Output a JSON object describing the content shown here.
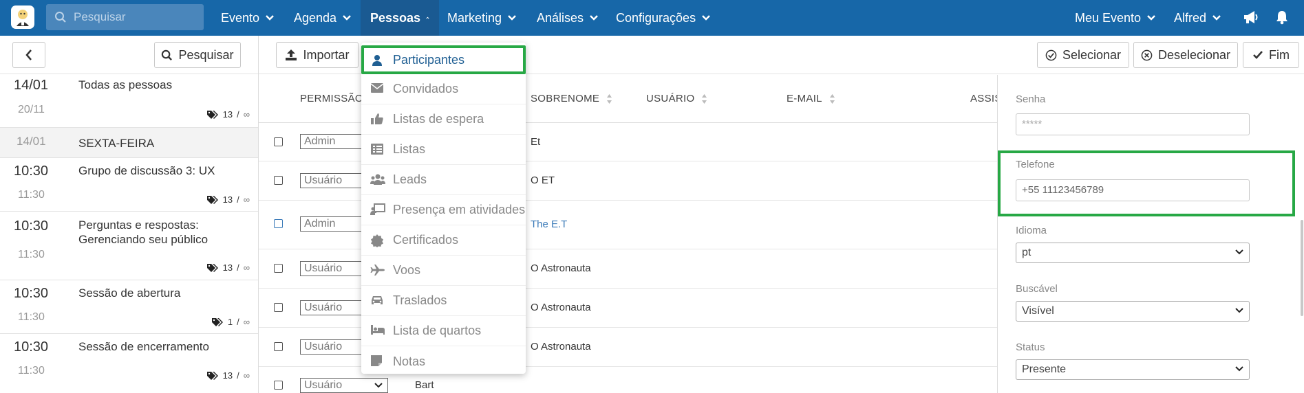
{
  "nav": {
    "search_placeholder": "Pesquisar",
    "items": [
      "Evento",
      "Agenda",
      "Pessoas",
      "Marketing",
      "Análises",
      "Configurações"
    ],
    "active": "Pessoas",
    "right_items": [
      "Meu Evento",
      "Alfred"
    ]
  },
  "toolbar": {
    "search_label": "Pesquisar",
    "import_label": "Importar",
    "select_label": "Selecionar",
    "deselect_label": "Deselecionar",
    "done_label": "Fim"
  },
  "sessions": [
    {
      "start": "14/01",
      "end": "20/11",
      "title": "Todas as pessoas",
      "tags": "13",
      "inf": "∞"
    },
    {
      "start": "14/01",
      "end": "",
      "title": "SEXTA-FEIRA",
      "tags": "",
      "inf": ""
    },
    {
      "start": "10:30",
      "end": "11:30",
      "title": "Grupo de discussão 3: UX",
      "tags": "13",
      "inf": "∞"
    },
    {
      "start": "10:30",
      "end": "11:30",
      "title": "Perguntas e respostas: Gerenciando seu público",
      "tags": "13",
      "inf": "∞"
    },
    {
      "start": "10:30",
      "end": "11:30",
      "title": "Sessão de abertura",
      "tags": "1",
      "inf": "∞"
    },
    {
      "start": "10:30",
      "end": "11:30",
      "title": "Sessão de encerramento",
      "tags": "13",
      "inf": "∞"
    }
  ],
  "table": {
    "headers": [
      "PERMISSÃO",
      "SOBRENOME",
      "USUÁRIO",
      "E-MAIL",
      "ASSIS"
    ],
    "rows": [
      {
        "permission": "Admin",
        "surname": "Et"
      },
      {
        "permission": "Usuário",
        "surname": "O ET"
      },
      {
        "permission": "Admin",
        "surname": "The E.T"
      },
      {
        "permission": "Usuário",
        "surname": "O Astronauta"
      },
      {
        "permission": "Usuário",
        "surname": "O Astronauta"
      },
      {
        "permission": "Usuário",
        "surname": "O Astronauta"
      },
      {
        "permission": "Usuário",
        "surname": "Bart"
      }
    ]
  },
  "menu": {
    "items": [
      "Participantes",
      "Convidados",
      "Listas de espera",
      "Listas",
      "Leads",
      "Presença em atividades",
      "Certificados",
      "Voos",
      "Traslados",
      "Lista de quartos",
      "Notas"
    ],
    "selected": "Participantes"
  },
  "form": {
    "password_label": "Senha",
    "password_value": "*****",
    "phone_label": "Telefone",
    "phone_value": "+55 11123456789",
    "language_label": "Idioma",
    "language_value": "pt",
    "searchable_label": "Buscável",
    "searchable_value": "Visível",
    "status_label": "Status",
    "status_value": "Presente"
  },
  "colors": {
    "nav_bg": "#1767a8",
    "highlight": "#27a845",
    "selected_text": "#1f5f93",
    "link": "#3a7ab8"
  }
}
